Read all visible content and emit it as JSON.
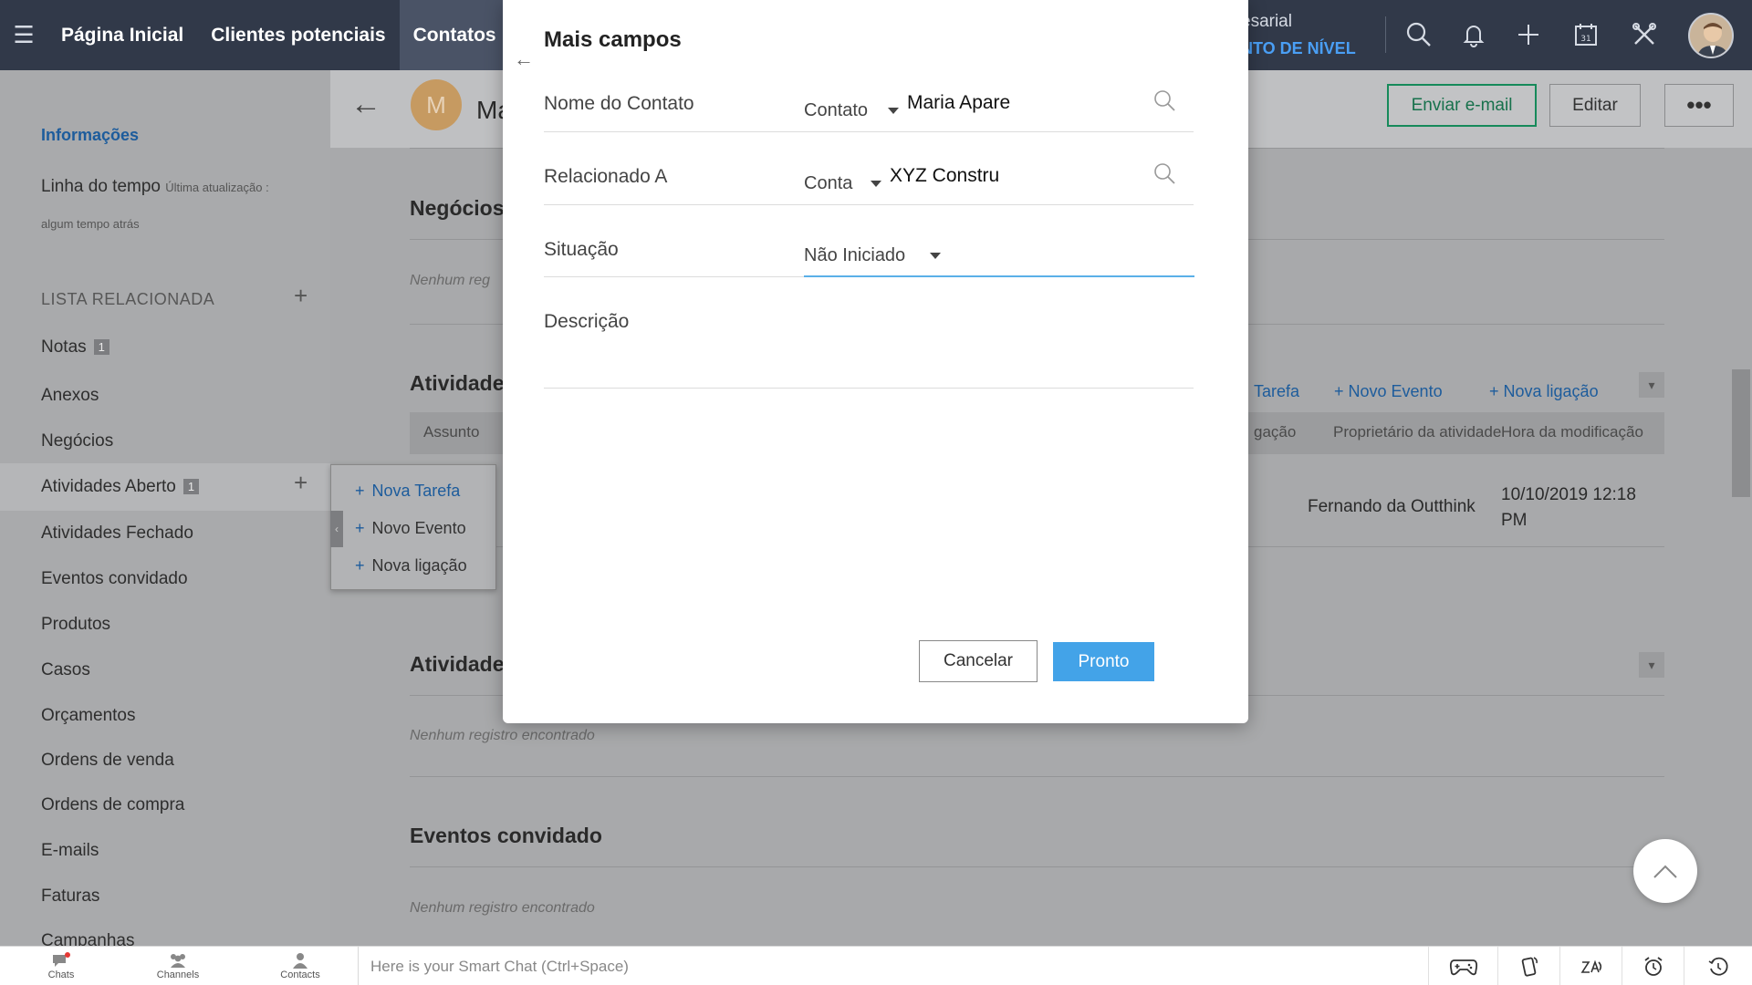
{
  "nav": {
    "tabs": [
      "Página Inicial",
      "Clientes potenciais",
      "Contatos"
    ],
    "org_line1": "esarial",
    "org_line2": "NTO DE NÍVEL"
  },
  "sidebar": {
    "info": "Informações",
    "timeline_label": "Linha do tempo",
    "timeline_updated": "Última atualização :",
    "timeline_when": "algum tempo atrás",
    "related_header": "LISTA RELACIONADA",
    "items": [
      {
        "label": "Notas",
        "badge": "1"
      },
      {
        "label": "Anexos"
      },
      {
        "label": "Negócios"
      },
      {
        "label": "Atividades Aberto",
        "badge": "1"
      },
      {
        "label": "Atividades Fechado"
      },
      {
        "label": "Eventos convidado"
      },
      {
        "label": "Produtos"
      },
      {
        "label": "Casos"
      },
      {
        "label": "Orçamentos"
      },
      {
        "label": "Ordens de venda"
      },
      {
        "label": "Ordens de compra"
      },
      {
        "label": "E-mails"
      },
      {
        "label": "Faturas"
      },
      {
        "label": "Campanhas"
      }
    ]
  },
  "record": {
    "avatar_letter": "M",
    "name": "Ma",
    "send_email": "Enviar e-mail",
    "edit": "Editar",
    "more": "•••"
  },
  "sections": {
    "deals_title": "Negócios",
    "deals_empty": "Nenhum reg",
    "open_title": "Atividade",
    "new_task_partial": "Tarefa",
    "new_event": "Novo Evento",
    "new_call": "Nova ligação",
    "col_subject": "Assunto",
    "col_call_partial": "gação",
    "col_owner": "Proprietário da atividade",
    "col_modified": "Hora da modificação",
    "row_owner": "Fernando da Outthink",
    "row_modified_1": "10/10/2019 12:18",
    "row_modified_2": "PM",
    "closed_title": "Atividade",
    "closed_empty": "Nenhum registro encontrado",
    "events_title": "Eventos convidado",
    "events_empty": "Nenhum registro encontrado"
  },
  "popup": {
    "items": [
      "Nova Tarefa",
      "Novo Evento",
      "Nova ligação"
    ]
  },
  "modal": {
    "title": "Mais campos",
    "contact_label": "Nome do Contato",
    "contact_type": "Contato",
    "contact_value": "Maria Apare",
    "related_label": "Relacionado A",
    "related_type": "Conta",
    "related_value": "XYZ Constru",
    "status_label": "Situação",
    "status_value": "Não Iniciado",
    "description_label": "Descrição",
    "cancel": "Cancelar",
    "done": "Pronto"
  },
  "bottombar": {
    "tabs": [
      "Chats",
      "Channels",
      "Contacts"
    ],
    "chat_placeholder": "Here is your Smart Chat (Ctrl+Space)"
  },
  "colors": {
    "nav_bg": "#313949",
    "accent_blue": "#43a3e8",
    "email_green": "#168a5a",
    "link_blue": "#1d5c9c"
  }
}
